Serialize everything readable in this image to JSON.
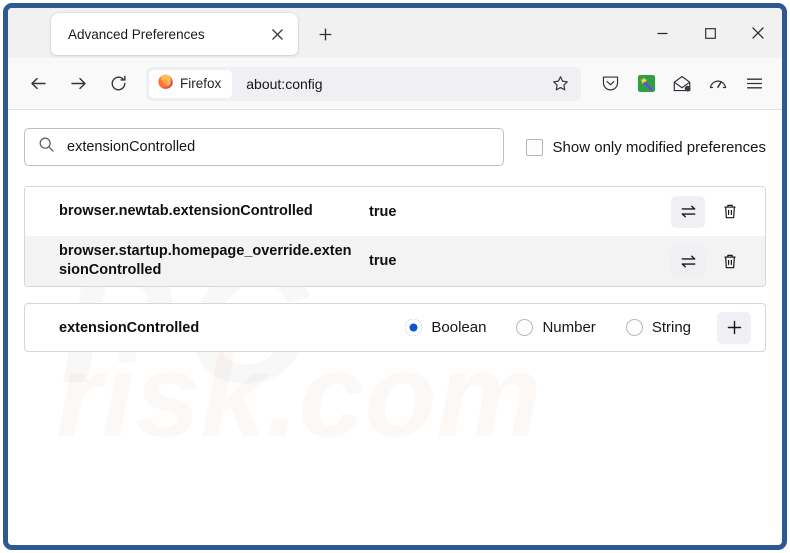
{
  "window": {
    "minimize_label": "–",
    "maximize_label": "□",
    "close_label": "✕",
    "frame_color": "#2e5894"
  },
  "tabs": {
    "active": {
      "title": "Advanced Preferences",
      "close_label": "✕"
    },
    "new_tab_label": "+"
  },
  "toolbar": {
    "back_label": "←",
    "forward_label": "→",
    "reload_label": "⟳",
    "identity_chip_label": "Firefox",
    "url": "about:config",
    "bookmark_label": "☆",
    "icons": [
      "pocket-icon",
      "magic-wand-extension-icon",
      "mail-envelope-icon",
      "speedometer-icon",
      "hamburger-menu-icon"
    ]
  },
  "search": {
    "value": "extensionControlled",
    "placeholder": "Search preference name",
    "icon": "search-icon"
  },
  "filter": {
    "label": "Show only modified preferences",
    "checked": false
  },
  "preferences": {
    "rows": [
      {
        "name": "browser.newtab.extensionControlled",
        "value": "true",
        "toggle_label": "⇌",
        "delete_label": "delete"
      },
      {
        "name": "browser.startup.homepage_override.extensionControlled",
        "value": "true",
        "toggle_label": "⇌",
        "delete_label": "delete"
      }
    ]
  },
  "add_new": {
    "name": "extensionControlled",
    "types": [
      {
        "label": "Boolean",
        "selected": true
      },
      {
        "label": "Number",
        "selected": false
      },
      {
        "label": "String",
        "selected": false
      }
    ],
    "add_label": "+",
    "accent_color": "#0a57d0"
  },
  "watermark": {
    "top": "PC",
    "bottom": "risk.com"
  }
}
